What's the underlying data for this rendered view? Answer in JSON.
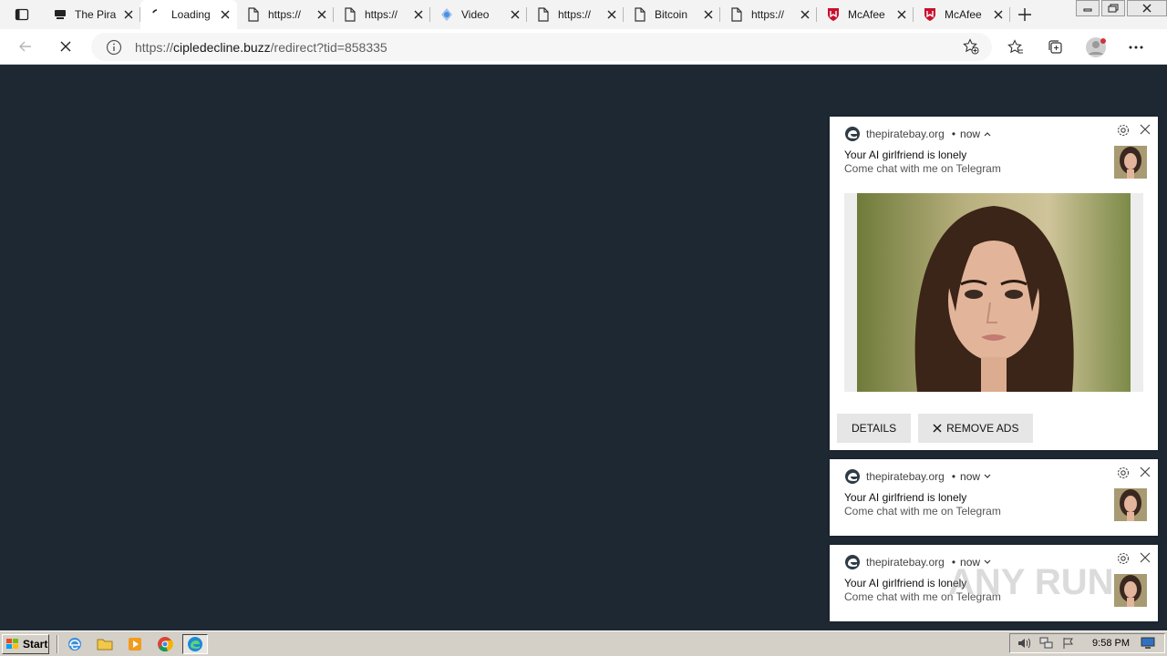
{
  "browser": {
    "tabs": [
      {
        "label": "The Pira",
        "icon": "page-icon"
      },
      {
        "label": "Loading",
        "icon": "loading-icon",
        "active": true
      },
      {
        "label": "https://",
        "icon": "page-icon"
      },
      {
        "label": "https://",
        "icon": "page-icon"
      },
      {
        "label": "Video",
        "icon": "video-icon"
      },
      {
        "label": "https://",
        "icon": "page-icon"
      },
      {
        "label": "Bitcoin",
        "icon": "page-icon"
      },
      {
        "label": "https://",
        "icon": "page-icon"
      },
      {
        "label": "McAfee",
        "icon": "mcafee-icon"
      },
      {
        "label": "McAfee",
        "icon": "mcafee-icon"
      }
    ],
    "address": {
      "prefix": "https://",
      "host": "cipledecline.buzz",
      "path": "/redirect?tid=858335"
    }
  },
  "notifications": [
    {
      "site": "thepiratebay.org",
      "time": "now",
      "title": "Your AI girlfriend is lonely",
      "body": "Come chat with me on Telegram",
      "actions": {
        "details": "DETAILS",
        "remove": "REMOVE ADS"
      }
    },
    {
      "site": "thepiratebay.org",
      "time": "now",
      "title": "Your AI girlfriend is lonely",
      "body": "Come chat with me on Telegram"
    },
    {
      "site": "thepiratebay.org",
      "time": "now",
      "title": "Your AI girlfriend is lonely",
      "body": "Come chat with me on Telegram"
    }
  ],
  "taskbar": {
    "start_label": "Start",
    "clock": "9:58 PM"
  },
  "watermark": {
    "text": "ANY RUN"
  },
  "colors": {
    "page_bg": "#1e2832",
    "mcafee_red": "#c8102e"
  }
}
